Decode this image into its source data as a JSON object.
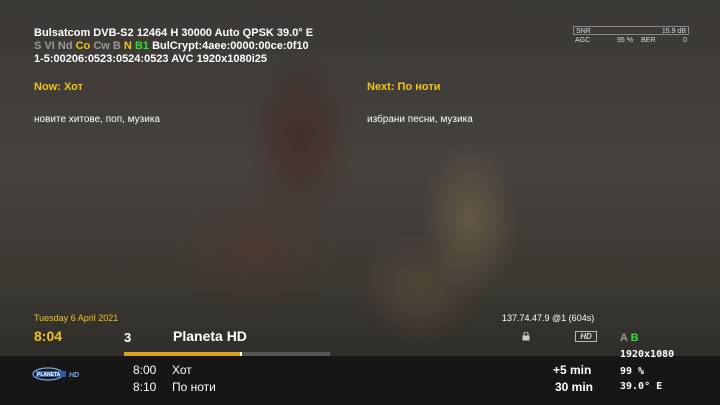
{
  "tuner": {
    "line1": "Bulsatcom DVB-S2 12464 H 30000 Auto QPSK 39.0° E",
    "line2_flags": {
      "s": "S",
      "v": "V",
      "i": "I",
      "nd": "Nd",
      "co": "Co",
      "cw": "Cw",
      "b": "B",
      "n": "N",
      "b1": "B1",
      "crypt": "BulCrypt:4aee:0000:00ce:0f10"
    },
    "line3": "1-5:00206:0523:0524:0523 AVC 1920x1080i25"
  },
  "signal": {
    "snr_label": "SNR",
    "snr_value": "15.9 dB",
    "agc_label": "AGC",
    "agc_value": "95 %",
    "ber_label": "BER",
    "ber_value": "0"
  },
  "epg": {
    "now_title": "Now: Хот",
    "now_desc": "новите хитове, поп, музика",
    "next_title": "Next: По ноти",
    "next_desc": "избрани песни, музика"
  },
  "infobar": {
    "date": "Tuesday  6 April 2021",
    "ip": "137.74.47.9 @1 (604s)",
    "clock": "8:04",
    "channel_number": "3",
    "channel_name": "Planeta HD",
    "hd_badge": "HD",
    "audio_tracks": "A",
    "audio_tracks_b": "B",
    "progress": 0.57,
    "events": [
      {
        "time": "8:00",
        "title": "Хот",
        "duration": "+5 min"
      },
      {
        "time": "8:10",
        "title": "По ноти",
        "duration": "30 min"
      }
    ],
    "resolution": "1920x1080",
    "quality": "99 %",
    "orbital": "39.0° E",
    "logo_text": "PLANETA HD"
  },
  "colors": {
    "accent_yellow": "#f2c41a",
    "accent_green": "#30e030",
    "progress": "#d9a21a"
  }
}
